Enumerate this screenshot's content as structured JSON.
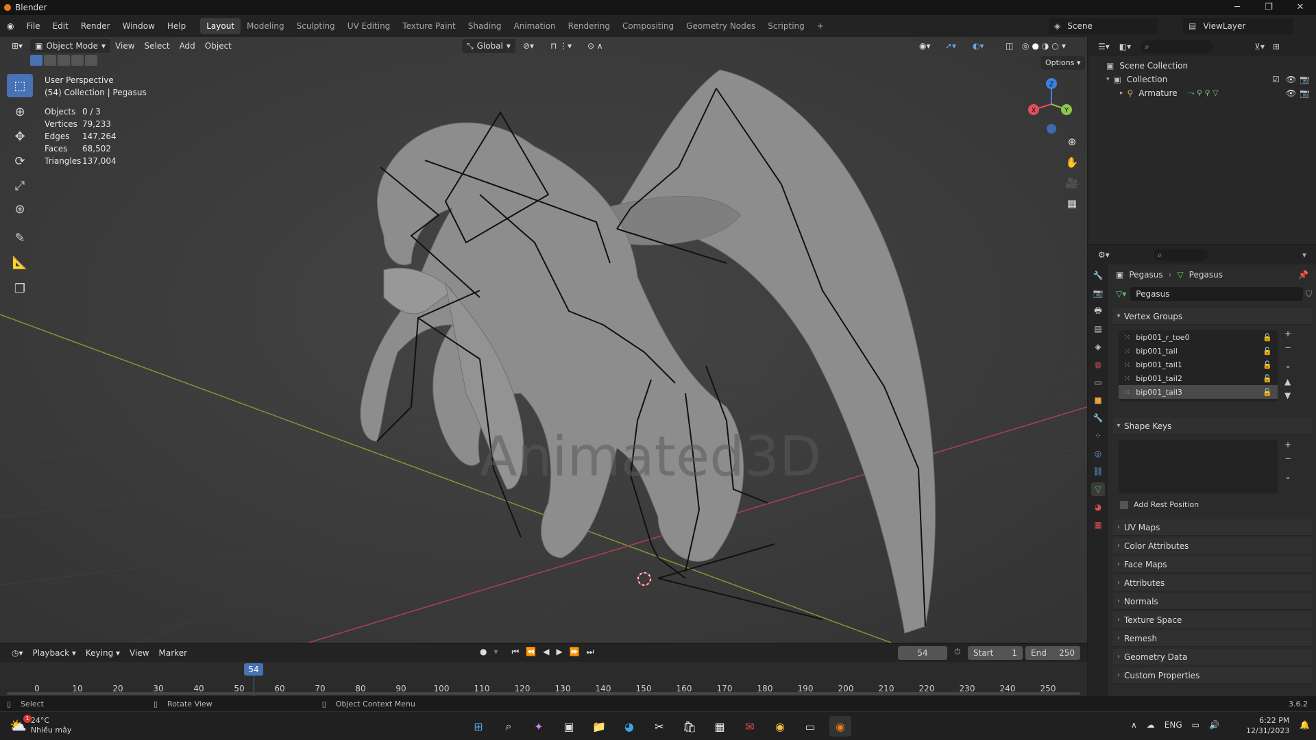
{
  "window": {
    "title": "Blender"
  },
  "menus": [
    "File",
    "Edit",
    "Render",
    "Window",
    "Help"
  ],
  "workspaces": [
    "Layout",
    "Modeling",
    "Sculpting",
    "UV Editing",
    "Texture Paint",
    "Shading",
    "Animation",
    "Rendering",
    "Compositing",
    "Geometry Nodes",
    "Scripting"
  ],
  "active_workspace": "Layout",
  "scene": {
    "name": "Scene",
    "view_layer": "ViewLayer"
  },
  "viewport": {
    "mode": "Object Mode",
    "menu": [
      "View",
      "Select",
      "Add",
      "Object"
    ],
    "orientation": "Global",
    "options_label": "Options",
    "perspective": "User Perspective",
    "collection_info": "(54) Collection | Pegasus",
    "stats": [
      {
        "label": "Objects",
        "value": "0 / 3"
      },
      {
        "label": "Vertices",
        "value": "79,233"
      },
      {
        "label": "Edges",
        "value": "147,264"
      },
      {
        "label": "Faces",
        "value": "68,502"
      },
      {
        "label": "Triangles",
        "value": "137,004"
      }
    ],
    "watermark": "Animated3D",
    "gizmo": {
      "x": "X",
      "y": "Y",
      "z": "Z"
    }
  },
  "outliner": {
    "root": "Scene Collection",
    "collection": "Collection",
    "armature": "Armature"
  },
  "properties": {
    "breadcrumb": [
      "Pegasus",
      "Pegasus"
    ],
    "mesh_name": "Pegasus",
    "vertex_groups_title": "Vertex Groups",
    "vertex_groups": [
      "bip001_r_toe0",
      "bip001_tail",
      "bip001_tail1",
      "bip001_tail2",
      "bip001_tail3"
    ],
    "selected_group": "bip001_tail3",
    "shape_keys_title": "Shape Keys",
    "add_rest_position": "Add Rest Position",
    "panels": [
      "UV Maps",
      "Color Attributes",
      "Face Maps",
      "Attributes",
      "Normals",
      "Texture Space",
      "Remesh",
      "Geometry Data",
      "Custom Properties"
    ]
  },
  "timeline": {
    "menus": [
      "Playback",
      "Keying",
      "View",
      "Marker"
    ],
    "current_frame": "54",
    "start_label": "Start",
    "start": "1",
    "end_label": "End",
    "end": "250",
    "ticks": [
      "0",
      "10",
      "20",
      "30",
      "40",
      "50",
      "60",
      "70",
      "80",
      "90",
      "100",
      "110",
      "120",
      "130",
      "140",
      "150",
      "160",
      "170",
      "180",
      "190",
      "200",
      "210",
      "220",
      "230",
      "240",
      "250"
    ]
  },
  "statusbar": {
    "select": "Select",
    "rotate": "Rotate View",
    "context": "Object Context Menu",
    "version": "3.6.2"
  },
  "taskbar": {
    "temp": "24°C",
    "weather": "Nhiều mây",
    "lang": "ENG",
    "time": "6:22 PM",
    "date": "12/31/2023",
    "badge": "1"
  },
  "colors": {
    "accent": "#4772b3",
    "x_axis": "#e34e5f",
    "y_axis": "#8ac74c",
    "z_axis": "#3d83e3",
    "bones": "#111111",
    "mesh": "#8a8a8a"
  }
}
